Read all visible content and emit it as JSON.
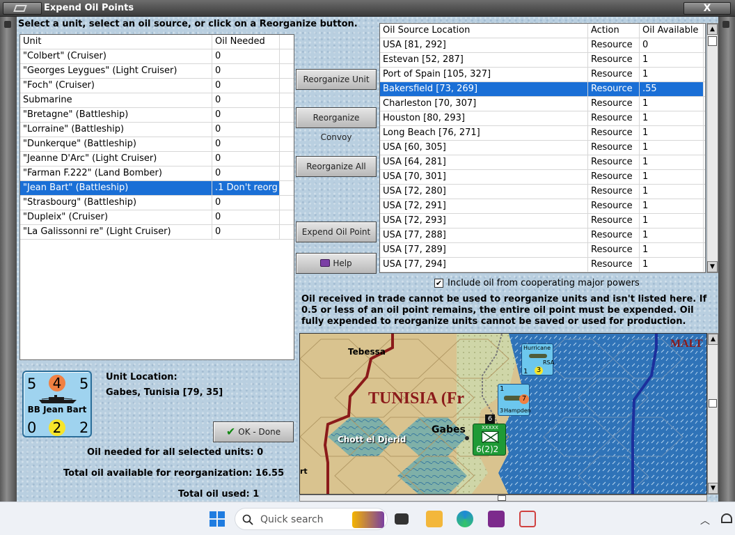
{
  "window": {
    "title": "Expend Oil Points",
    "close_glyph": "X"
  },
  "instruction": "Select a unit, select an oil source, or click on a Reorganize button.",
  "unit_table": {
    "headers": [
      "Unit",
      "Oil Needed"
    ],
    "rows": [
      {
        "unit": "\"Colbert\" (Cruiser)",
        "oil": "0"
      },
      {
        "unit": "\"Georges Leygues\" (Light Cruiser)",
        "oil": "0"
      },
      {
        "unit": "\"Foch\" (Cruiser)",
        "oil": "0"
      },
      {
        "unit": "Submarine",
        "oil": "0"
      },
      {
        "unit": "\"Bretagne\" (Battleship)",
        "oil": "0"
      },
      {
        "unit": "\"Lorraine\" (Battleship)",
        "oil": "0"
      },
      {
        "unit": "\"Dunkerque\" (Battleship)",
        "oil": "0"
      },
      {
        "unit": "\"Jeanne D'Arc\" (Light Cruiser)",
        "oil": "0"
      },
      {
        "unit": "\"Farman F.222\" (Land Bomber)",
        "oil": "0"
      },
      {
        "unit": "\"Jean Bart\" (Battleship)",
        "oil": ".1 Don't reorg"
      },
      {
        "unit": "\"Strasbourg\" (Battleship)",
        "oil": "0"
      },
      {
        "unit": "\"Dupleix\" (Cruiser)",
        "oil": "0"
      },
      {
        "unit": "\"La Galissonni re\" (Light Cruiser)",
        "oil": "0"
      }
    ],
    "selected_index": 9
  },
  "buttons": {
    "reorganize_unit": "Reorganize Unit",
    "reorganize_convoy": "Reorganize Convoy",
    "reorganize_all": "Reorganize All",
    "expend_oil_point": "Expend Oil Point",
    "help": "Help",
    "ok_done": "OK - Done"
  },
  "oil_table": {
    "headers": [
      "Oil Source Location",
      "Action",
      "Oil Available"
    ],
    "rows": [
      {
        "loc": "USA [81, 292]",
        "action": "Resource",
        "oil": "0"
      },
      {
        "loc": "Estevan [52, 287]",
        "action": "Resource",
        "oil": "1"
      },
      {
        "loc": "Port of Spain [105, 327]",
        "action": "Resource",
        "oil": "1"
      },
      {
        "loc": "Bakersfield [73, 269]",
        "action": "Resource",
        "oil": ".55"
      },
      {
        "loc": "Charleston [70, 307]",
        "action": "Resource",
        "oil": "1"
      },
      {
        "loc": "Houston [80, 293]",
        "action": "Resource",
        "oil": "1"
      },
      {
        "loc": "Long Beach [76, 271]",
        "action": "Resource",
        "oil": "1"
      },
      {
        "loc": "USA [60, 305]",
        "action": "Resource",
        "oil": "1"
      },
      {
        "loc": "USA [64, 281]",
        "action": "Resource",
        "oil": "1"
      },
      {
        "loc": "USA [70, 301]",
        "action": "Resource",
        "oil": "1"
      },
      {
        "loc": "USA [72, 280]",
        "action": "Resource",
        "oil": "1"
      },
      {
        "loc": "USA [72, 291]",
        "action": "Resource",
        "oil": "1"
      },
      {
        "loc": "USA [72, 293]",
        "action": "Resource",
        "oil": "1"
      },
      {
        "loc": "USA [77, 288]",
        "action": "Resource",
        "oil": "1"
      },
      {
        "loc": "USA [77, 289]",
        "action": "Resource",
        "oil": "1"
      },
      {
        "loc": "USA [77, 294]",
        "action": "Resource",
        "oil": "1"
      }
    ],
    "selected_index": 3
  },
  "checkbox": {
    "label": "Include oil from cooperating major powers",
    "checked": true,
    "glyph": "✔"
  },
  "notice": "Oil received in trade cannot be used to reorganize units and isn't listed here.  If 0.5 or less of an oil point remains, the entire oil point must be expended.   Oil fully expended to reorganize units cannot be saved or used for production.",
  "counter": {
    "top_left": "5",
    "top_mid": "4",
    "top_right": "5",
    "name": "BB Jean Bart",
    "bottom_left": "0",
    "bottom_mid": "2",
    "bottom_right": "2",
    "top_mid_color": "#f08042",
    "bottom_mid_color": "#f6e52a"
  },
  "unit_location": {
    "label": "Unit Location:",
    "value": "Gabes, Tunisia [79, 35]"
  },
  "totals": {
    "oil_needed_label": "Oil needed for all selected units:",
    "oil_needed_value": "0",
    "total_available_label": "Total oil available for reorganization:",
    "total_available_value": "16.55",
    "total_used_label": "Total oil used:",
    "total_used_value": "1"
  },
  "map": {
    "labels": {
      "tebessa": "Tebessa",
      "tunisia": "TUNISIA (Fr",
      "gabes": "Gabes",
      "chott": "Chott el Djerid",
      "malta": "MALT",
      "edge_rt": "rt"
    },
    "units": {
      "hurricane_name": "Hurricane",
      "hurricane_nation": "RSA",
      "hurricane_left": "1",
      "hurricane_right": "3",
      "hampden_name": "Hampden",
      "hampden_top": "1",
      "hampden_bottom": "3",
      "hampden_circle": "7",
      "corps_top": "XXXXX",
      "corps_value": "6(2)2",
      "stack_count": "6"
    },
    "colors": {
      "desert": "#d9c38f",
      "sea": "#2f73b8",
      "border": "#8b1a1a",
      "front": "#1c2f9c",
      "marsh": "#7fb0a8"
    }
  },
  "taskbar": {
    "search_placeholder": "Quick search"
  }
}
